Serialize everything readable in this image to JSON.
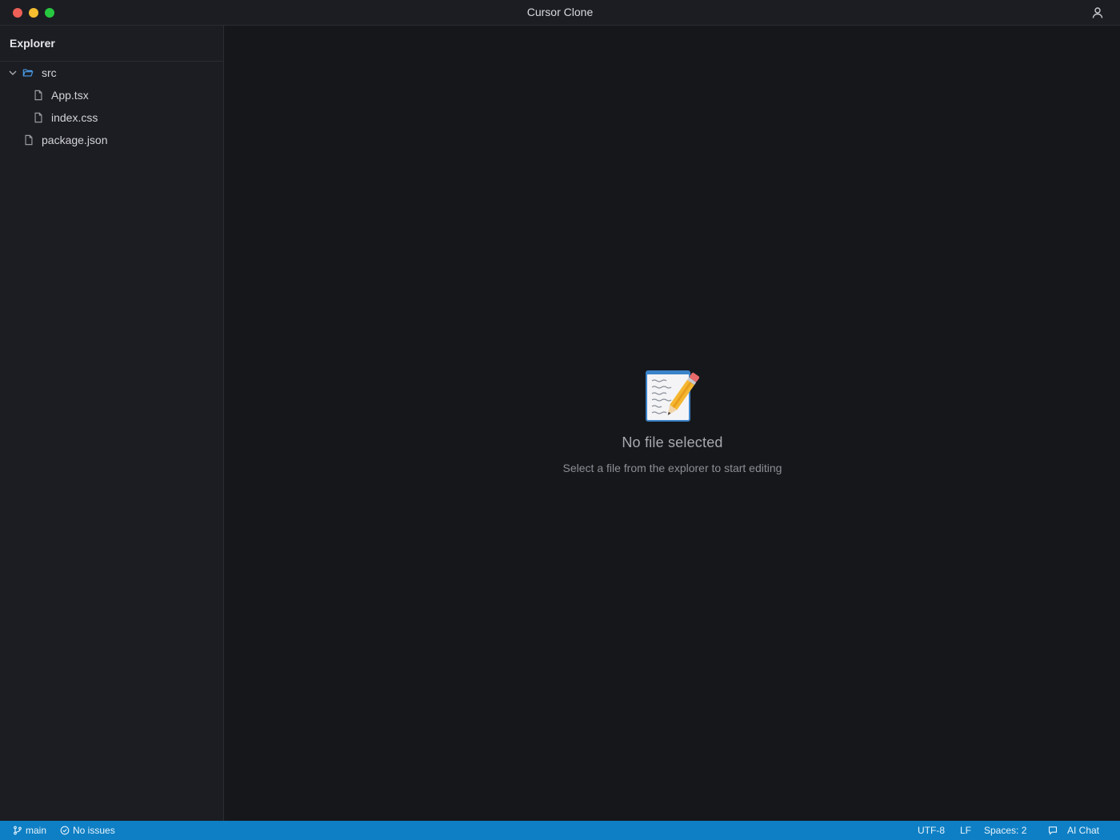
{
  "window": {
    "title": "Cursor Clone",
    "traffic_colors": {
      "close": "#ed5f57",
      "minimize": "#f5bd2f",
      "maximize": "#27c840"
    }
  },
  "sidebar": {
    "title": "Explorer",
    "tree": [
      {
        "label": "src",
        "type": "folder",
        "expanded": true
      },
      {
        "label": "App.tsx",
        "type": "file"
      },
      {
        "label": "index.css",
        "type": "file"
      },
      {
        "label": "package.json",
        "type": "file"
      }
    ]
  },
  "editor": {
    "empty_icon": "memo-icon",
    "empty_title": "No file selected",
    "empty_subtitle": "Select a file from the explorer to start editing"
  },
  "statusbar": {
    "branch": "main",
    "issues": "No issues",
    "encoding": "UTF-8",
    "line_ending": "LF",
    "indent": "Spaces: 2",
    "ai_chat": "AI Chat",
    "color": "#0e7fc4"
  },
  "colors": {
    "accent": "#0e7fc4",
    "folder_icon": "#4a9be8"
  }
}
